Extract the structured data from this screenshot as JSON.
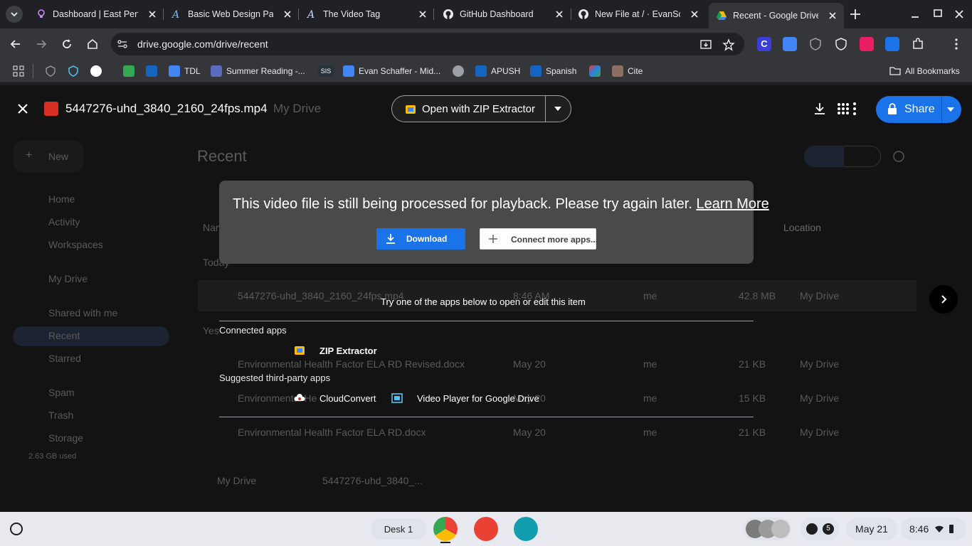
{
  "browser": {
    "tabs": [
      {
        "title": "Dashboard | East Penn",
        "icon": "lightbulb-icon",
        "active": false
      },
      {
        "title": "Basic Web Design Part",
        "icon": "a-logo-icon",
        "active": false
      },
      {
        "title": "The Video Tag",
        "icon": "a-logo-icon",
        "active": false
      },
      {
        "title": "GitHub Dashboard",
        "icon": "github-icon",
        "active": false
      },
      {
        "title": "New File at / · EvanSch",
        "icon": "github-icon",
        "active": false
      },
      {
        "title": "Recent - Google Drive",
        "icon": "google-drive-icon",
        "active": true
      }
    ],
    "url": "drive.google.com/drive/recent",
    "bookmarks": [
      {
        "label": "",
        "icon": "shield-icon"
      },
      {
        "label": "",
        "icon": "shield-icon"
      },
      {
        "label": "",
        "icon": "google-icon"
      },
      {
        "label": "",
        "icon": "green-app-icon"
      },
      {
        "label": "",
        "icon": "paypal-icon"
      },
      {
        "label": "TDL",
        "icon": "docs-icon"
      },
      {
        "label": "Summer Reading -...",
        "icon": "forms-icon"
      },
      {
        "label": "",
        "icon": "sis-icon"
      },
      {
        "label": "Evan Schaffer - Mid...",
        "icon": "docs-icon"
      },
      {
        "label": "",
        "icon": "globe-icon"
      },
      {
        "label": "APUSH",
        "icon": "paypal-icon"
      },
      {
        "label": "Spanish",
        "icon": "paypal-icon"
      },
      {
        "label": "",
        "icon": "pencils-icon"
      },
      {
        "label": "Cite",
        "icon": "cite-icon"
      }
    ],
    "all_bookmarks": "All Bookmarks",
    "sis_label": "SIS"
  },
  "drive_background": {
    "breadcrumb": "My Drive",
    "page_title": "Recent",
    "new_button": "New",
    "sidebar": [
      "Home",
      "Activity",
      "Workspaces",
      "My Drive",
      "Shared with me",
      "Recent",
      "Starred",
      "Spam",
      "Trash",
      "Storage"
    ],
    "storage_used": "2.63 GB used",
    "columns": {
      "name": "Name",
      "location": "Location"
    },
    "groups": {
      "today": "Today",
      "yesterday": "Yes"
    },
    "files": [
      {
        "name": "5447276-uhd_3840_2160_24fps.mp4",
        "modified": "8:46 AM",
        "owner": "me",
        "size": "42.8 MB",
        "location": "My Drive"
      },
      {
        "name": "Environmental Health Factor ELA RD Revised.docx",
        "modified": "May 20",
        "owner": "me",
        "size": "21 KB",
        "location": "My Drive"
      },
      {
        "name": "Environmental He",
        "modified": "May 20",
        "owner": "me",
        "size": "15 KB",
        "location": "My Drive"
      },
      {
        "name": "Environmental Health Factor ELA RD.docx",
        "modified": "May 20",
        "owner": "me",
        "size": "21 KB",
        "location": "My Drive"
      }
    ],
    "footer_path": {
      "root": "My Drive",
      "file": "5447276-uhd_3840_..."
    }
  },
  "viewer": {
    "file_name": "5447276-uhd_3840_2160_24fps.mp4",
    "open_with_label": "Open with ZIP Extractor",
    "share_label": "Share",
    "notice": {
      "message": "This video file is still being processed for playback. Please try again later.",
      "learn_more": "Learn More",
      "download_label": "Download",
      "connect_label": "Connect more apps..."
    },
    "try_text": "Try one of the apps below to open or edit this item",
    "connected_title": "Connected apps",
    "connected_apps": [
      {
        "name": "ZIP Extractor",
        "icon": "zip-extractor-icon"
      }
    ],
    "suggested_title": "Suggested third-party apps",
    "suggested_apps": [
      {
        "name": "CloudConvert",
        "icon": "cloudconvert-icon"
      },
      {
        "name": "Video Player for Google Drive",
        "icon": "video-player-icon"
      }
    ]
  },
  "shelf": {
    "desk_label": "Desk 1",
    "notification_count": "5",
    "date": "May 21",
    "time": "8:46"
  },
  "colors": {
    "accent": "#1a73e8",
    "notice_bg": "#4a4a4a",
    "shelf_bg": "#e8eaf0"
  }
}
